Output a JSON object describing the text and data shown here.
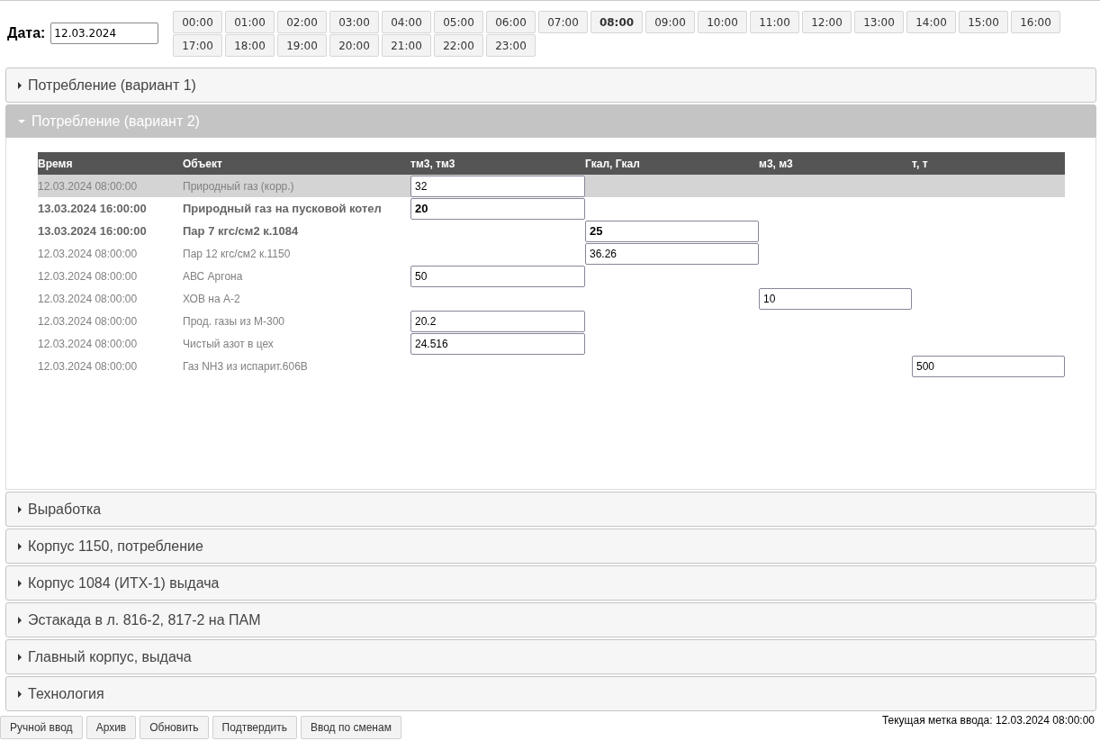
{
  "date_filter": {
    "label": "Дата:",
    "value": "12.03.2024"
  },
  "hours": [
    {
      "label": "00:00",
      "selected": false
    },
    {
      "label": "01:00",
      "selected": false
    },
    {
      "label": "02:00",
      "selected": false
    },
    {
      "label": "03:00",
      "selected": false
    },
    {
      "label": "04:00",
      "selected": false
    },
    {
      "label": "05:00",
      "selected": false
    },
    {
      "label": "06:00",
      "selected": false
    },
    {
      "label": "07:00",
      "selected": false
    },
    {
      "label": "08:00",
      "selected": true
    },
    {
      "label": "09:00",
      "selected": false
    },
    {
      "label": "10:00",
      "selected": false
    },
    {
      "label": "11:00",
      "selected": false
    },
    {
      "label": "12:00",
      "selected": false
    },
    {
      "label": "13:00",
      "selected": false
    },
    {
      "label": "14:00",
      "selected": false
    },
    {
      "label": "15:00",
      "selected": false
    },
    {
      "label": "16:00",
      "selected": false
    },
    {
      "label": "17:00",
      "selected": false
    },
    {
      "label": "18:00",
      "selected": false
    },
    {
      "label": "19:00",
      "selected": false
    },
    {
      "label": "20:00",
      "selected": false
    },
    {
      "label": "21:00",
      "selected": false
    },
    {
      "label": "22:00",
      "selected": false
    },
    {
      "label": "23:00",
      "selected": false
    }
  ],
  "sections": [
    {
      "title": "Потребление (вариант 1)",
      "expanded": false
    },
    {
      "title": "Потребление (вариант 2)",
      "expanded": true,
      "table": {
        "columns": [
          "Время",
          "Объект",
          "тм3, тм3",
          "Гкал, Гкал",
          "м3, м3",
          "т, т"
        ],
        "rows": [
          {
            "time": "12.03.2024 08:00:00",
            "object": "Природный газ (корр.)",
            "selected": true,
            "bold": false,
            "tm3": "32"
          },
          {
            "time": "13.03.2024 16:00:00",
            "object": "Природный газ на пусковой котел",
            "selected": false,
            "bold": true,
            "tm3": "20"
          },
          {
            "time": "13.03.2024 16:00:00",
            "object": "Пар 7 кгс/см2 к.1084",
            "selected": false,
            "bold": true,
            "gcal": "25"
          },
          {
            "time": "12.03.2024 08:00:00",
            "object": "Пар 12 кгс/см2 к.1150",
            "selected": false,
            "bold": false,
            "gcal": "36.26"
          },
          {
            "time": "12.03.2024 08:00:00",
            "object": "АВС Аргона",
            "selected": false,
            "bold": false,
            "tm3": "50"
          },
          {
            "time": "12.03.2024 08:00:00",
            "object": "ХОВ на А-2",
            "selected": false,
            "bold": false,
            "m3": "10"
          },
          {
            "time": "12.03.2024 08:00:00",
            "object": "Прод. газы из М-300",
            "selected": false,
            "bold": false,
            "tm3": "20.2"
          },
          {
            "time": "12.03.2024 08:00:00",
            "object": "Чистый азот в цех",
            "selected": false,
            "bold": false,
            "tm3": "24.516"
          },
          {
            "time": "12.03.2024 08:00:00",
            "object": "Газ NH3 из испарит.606В",
            "selected": false,
            "bold": false,
            "t": "500"
          }
        ]
      }
    },
    {
      "title": "Выработка",
      "expanded": false
    },
    {
      "title": "Корпус 1150, потребление",
      "expanded": false
    },
    {
      "title": "Корпус 1084 (ИТХ-1) выдача",
      "expanded": false
    },
    {
      "title": "Эстакада в л. 816-2, 817-2 на ПАМ",
      "expanded": false
    },
    {
      "title": "Главный корпус, выдача",
      "expanded": false
    },
    {
      "title": "Технология",
      "expanded": false
    }
  ],
  "footer_buttons": [
    "Ручной ввод",
    "Архив",
    "Обновить",
    "Подтвердить",
    "Ввод по сменам"
  ],
  "status": "Текущая метка ввода: 12.03.2024 08:00:00"
}
